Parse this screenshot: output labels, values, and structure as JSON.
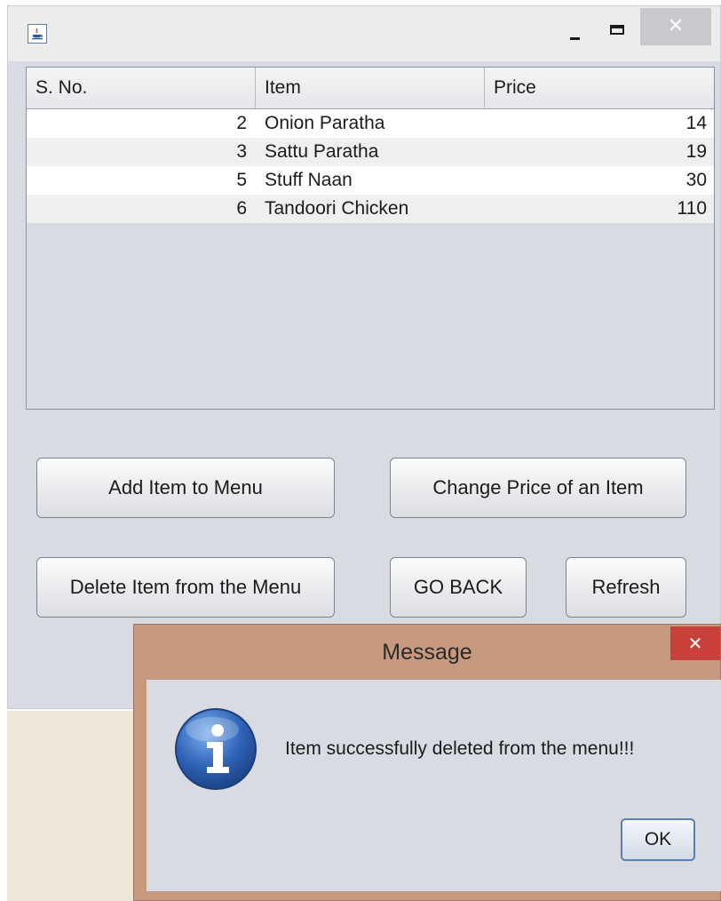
{
  "window": {
    "icon": "java-app-icon",
    "controls": {
      "minimize": "minimize-icon",
      "maximize": "maximize-icon",
      "close_glyph": "✕"
    }
  },
  "table": {
    "columns": [
      "S. No.",
      "Item",
      "Price"
    ],
    "rows": [
      {
        "sno": "2",
        "item": "Onion Paratha",
        "price": "14"
      },
      {
        "sno": "3",
        "item": "Sattu Paratha",
        "price": "19"
      },
      {
        "sno": "5",
        "item": "Stuff Naan",
        "price": "30"
      },
      {
        "sno": "6",
        "item": "Tandoori Chicken",
        "price": "110"
      }
    ]
  },
  "buttons": {
    "add": "Add Item to Menu",
    "change": "Change Price of an Item",
    "delete": "Delete Item from the Menu",
    "goback": "GO BACK",
    "refresh": "Refresh"
  },
  "dialog": {
    "title": "Message",
    "close_glyph": "✕",
    "icon": "info-icon",
    "message": "Item successfully deleted from the menu!!!",
    "ok": "OK"
  },
  "colors": {
    "window_bg": "#d9dbe3",
    "dialog_frame": "#c79a80",
    "dialog_close": "#c9403b",
    "info_blue": "#2f64b8"
  }
}
